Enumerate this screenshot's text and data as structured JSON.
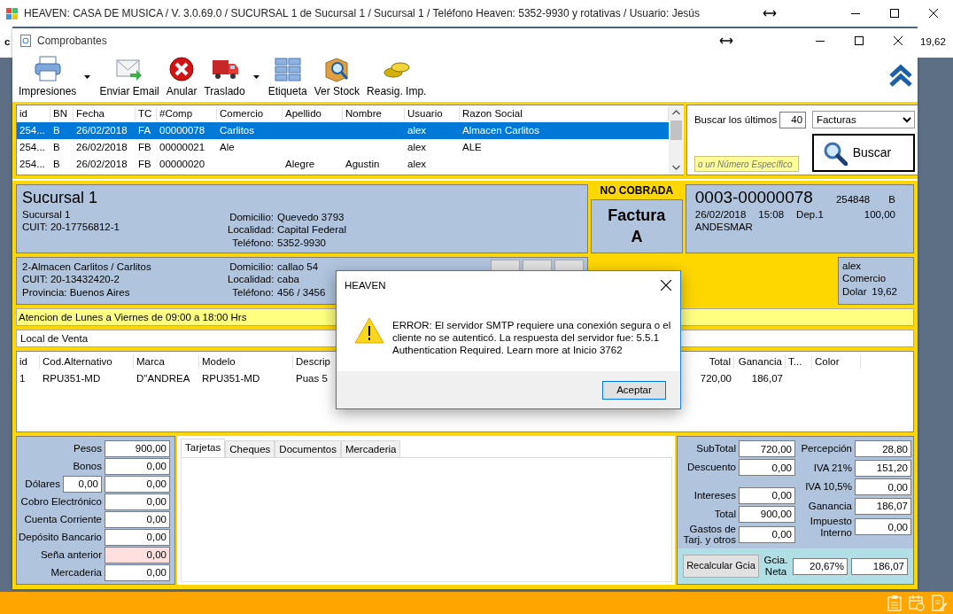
{
  "app_window": {
    "title": "HEAVEN: CASA DE MUSICA / V. 3.0.69.0 / SUCURSAL 1 de Sucursal 1 / Sucursal 1 / Teléfono Heaven: 5352-9930 y rotativas / Usuario: Jesús"
  },
  "background_window": {
    "left_text": "c",
    "right_text": "19,62"
  },
  "window": {
    "title": "Comprobantes"
  },
  "toolbar": [
    {
      "label": "Impresiones",
      "kind": "printer",
      "dropdown": true
    },
    {
      "label": "Enviar Email",
      "kind": "email",
      "dropdown": false
    },
    {
      "label": "Anular",
      "kind": "cancel",
      "dropdown": false
    },
    {
      "label": "Traslado",
      "kind": "truck",
      "dropdown": true
    },
    {
      "label": "Etiqueta",
      "kind": "grid",
      "dropdown": false
    },
    {
      "label": "Ver Stock",
      "kind": "stock",
      "dropdown": false
    },
    {
      "label": "Reasig. Imp.",
      "kind": "coins",
      "dropdown": false
    }
  ],
  "receipts_table": {
    "columns": [
      "id",
      "BN",
      "Fecha",
      "TC",
      "#Comp",
      "Comercio",
      "Apellido",
      "Nombre",
      "Usuario",
      "Razon Social"
    ],
    "rows": [
      {
        "cells": [
          "254...",
          "B",
          "26/02/2018",
          "FA",
          "00000078",
          "Carlitos",
          null,
          null,
          "alex",
          "Almacen Carlitos"
        ],
        "selected": true
      },
      {
        "cells": [
          "254...",
          "B",
          "26/02/2018",
          "FB",
          "00000021",
          "Ale",
          null,
          null,
          "alex",
          "ALE"
        ],
        "selected": false
      },
      {
        "cells": [
          "254...",
          "B",
          "26/02/2018",
          "FB",
          "00000020",
          null,
          "Alegre",
          "Agustin",
          "alex",
          null
        ],
        "selected": false
      }
    ]
  },
  "search": {
    "label": "Buscar los últimos",
    "count": "40",
    "type": "Facturas",
    "placeholder": "o un Número Específico",
    "button": "Buscar"
  },
  "branch": {
    "heading": "Sucursal 1",
    "lines": [
      "Sucursal 1",
      "CUIT:  20-17756812-1"
    ],
    "details": [
      {
        "label": "Domicilio:",
        "value": "Quevedo 3793"
      },
      {
        "label": "Localidad:",
        "value": "Capital Federal"
      },
      {
        "label": "Teléfono:",
        "value": "5352-9930"
      }
    ]
  },
  "status": "NO COBRADA",
  "document_type": "Factura A",
  "receipt": {
    "number": "0003-00000078",
    "id": "254848",
    "letter": "B",
    "date": "26/02/2018",
    "time": "15:08",
    "deposit": "Dep.1",
    "amount": "100,00",
    "carrier": "ANDESMAR"
  },
  "client": {
    "lines": [
      "2-Almacen Carlitos / Carlitos",
      "CUIT: 20-13432420-2",
      "Provincia:  Buenos Aires"
    ],
    "details": [
      {
        "label": "Domicilio:",
        "value": "callao 54"
      },
      {
        "label": "Localidad:",
        "value": "caba"
      },
      {
        "label": "Teléfono:",
        "value": "456 / 3456"
      }
    ]
  },
  "seller": {
    "user": "alex",
    "type": "Comercio",
    "currency": "Dolar",
    "rate": "19,62"
  },
  "notice": "Atencion de Lunes a Viernes  de 09:00 a 18:00 Hrs",
  "location": "Local de Venta",
  "items_table": {
    "columns": [
      "id",
      "Cod.Alternativo",
      "Marca",
      "Modelo",
      "Descrip",
      "Total",
      "Ganancia",
      "T...",
      "Color"
    ],
    "rows": [
      {
        "cells": [
          "1",
          "RPU351-MD",
          "D\"ANDREA",
          "RPU351-MD",
          "Puas 5",
          "720,00",
          "186,07"
        ]
      }
    ]
  },
  "payments": [
    {
      "label": "Pesos",
      "value": "900,00",
      "highlighted": false
    },
    {
      "label": "Bonos",
      "value": "0,00",
      "highlighted": false
    },
    {
      "label": "Dólares",
      "extra": "0,00",
      "value": "0,00",
      "highlighted": false
    },
    {
      "label": "Cobro Electrónico",
      "value": "0,00",
      "highlighted": false
    },
    {
      "label": "Cuenta Corriente",
      "value": "0,00",
      "highlighted": false
    },
    {
      "label": "Depósito Bancario",
      "value": "0,00",
      "highlighted": false
    },
    {
      "label": "Seña anterior",
      "value": "0,00",
      "highlighted": true
    },
    {
      "label": "Mercaderia",
      "value": "0,00",
      "highlighted": false
    }
  ],
  "tabs": [
    {
      "label": "Tarjetas",
      "selected": true
    },
    {
      "label": "Cheques",
      "selected": false
    },
    {
      "label": "Documentos",
      "selected": false
    },
    {
      "label": "Mercaderia",
      "selected": false
    }
  ],
  "totals": {
    "left_top": [
      {
        "label": "SubTotal",
        "value": "720,00"
      },
      {
        "label": "Descuento",
        "value": "0,00"
      }
    ],
    "left_bottom": [
      {
        "label": "Intereses",
        "value": "0,00"
      },
      {
        "label": "Total",
        "value": "900,00"
      },
      {
        "label": "Gastos de Tarj. y otros",
        "value": "0,00"
      }
    ],
    "right": [
      {
        "label": "Percepción",
        "value": "28,80"
      },
      {
        "label": "IVA 21%",
        "value": "151,20"
      },
      {
        "label": "IVA 10,5%",
        "value": "0,00"
      },
      {
        "label": "Ganancia",
        "value": "186,07"
      },
      {
        "label": "Impuesto Interno",
        "value": "0,00"
      }
    ],
    "recalc_button": "Recalcular Gcia",
    "net_label": "Gcia. Neta",
    "net_percent": "20,67%",
    "net_value": "186,07"
  },
  "dialog": {
    "title": "HEAVEN",
    "message": "ERROR: El servidor SMTP requiere una conexión segura o el cliente no se autenticó. La respuesta del servidor fue: 5.5.1 Authentication Required. Learn more at Inicio 3762",
    "button": "Aceptar"
  }
}
